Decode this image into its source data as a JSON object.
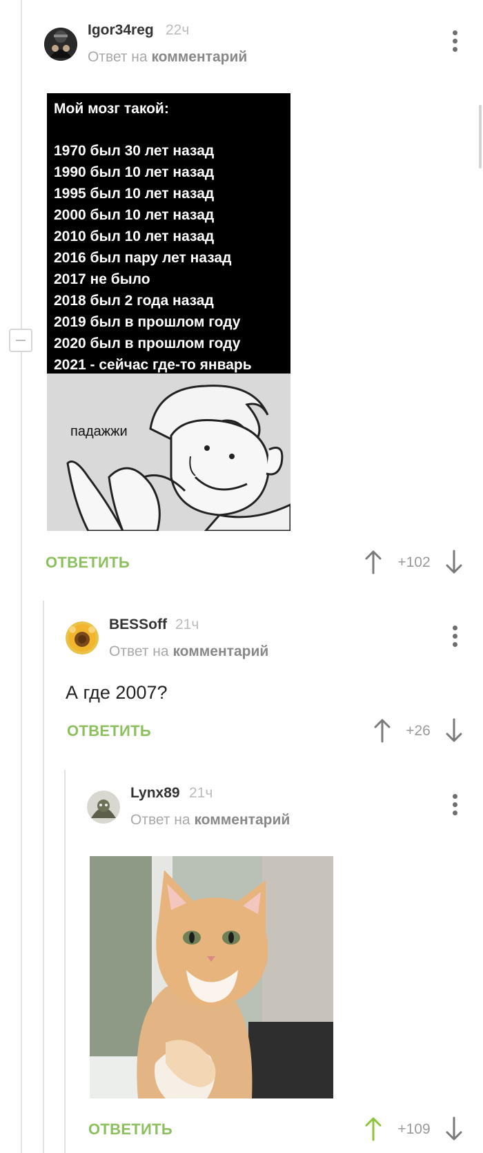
{
  "comments": [
    {
      "username": "Igor34reg",
      "time": "22ч",
      "reply_prefix": "Ответ на",
      "reply_link": "комментарий",
      "reply_label": "ОТВЕТИТЬ",
      "score": "+102",
      "image": {
        "title": "Мой мозг такой:",
        "lines": [
          "1970 был 30 лет назад",
          "1990 был 10 лет назад",
          "1995 был 10 лет назад",
          "2000 был 10 лет назад",
          "2010 был 10 лет назад",
          "2016 был пару лет назад",
          "2017 не было",
          "2018 был 2 года назад",
          "2019 был в прошлом году",
          "2020 был в прошлом году",
          "2021 - сейчас где-то январь"
        ],
        "caption": "падажжи"
      }
    },
    {
      "username": "BESSoff",
      "time": "21ч",
      "reply_prefix": "Ответ на",
      "reply_link": "комментарий",
      "text": "А где 2007?",
      "reply_label": "ОТВЕТИТЬ",
      "score": "+26"
    },
    {
      "username": "Lynx89",
      "time": "21ч",
      "reply_prefix": "Ответ на",
      "reply_link": "комментарий",
      "reply_label": "ОТВЕТИТЬ",
      "score": "+109",
      "upvoted": true
    }
  ],
  "colors": {
    "accent_green": "#8cbf5e",
    "upvote_active": "#8cc43c",
    "thread_line": "#e2e2e2"
  },
  "icons": [
    "avatar",
    "more-vertical-icon",
    "arrow-up-icon",
    "arrow-down-icon",
    "collapse-icon"
  ]
}
